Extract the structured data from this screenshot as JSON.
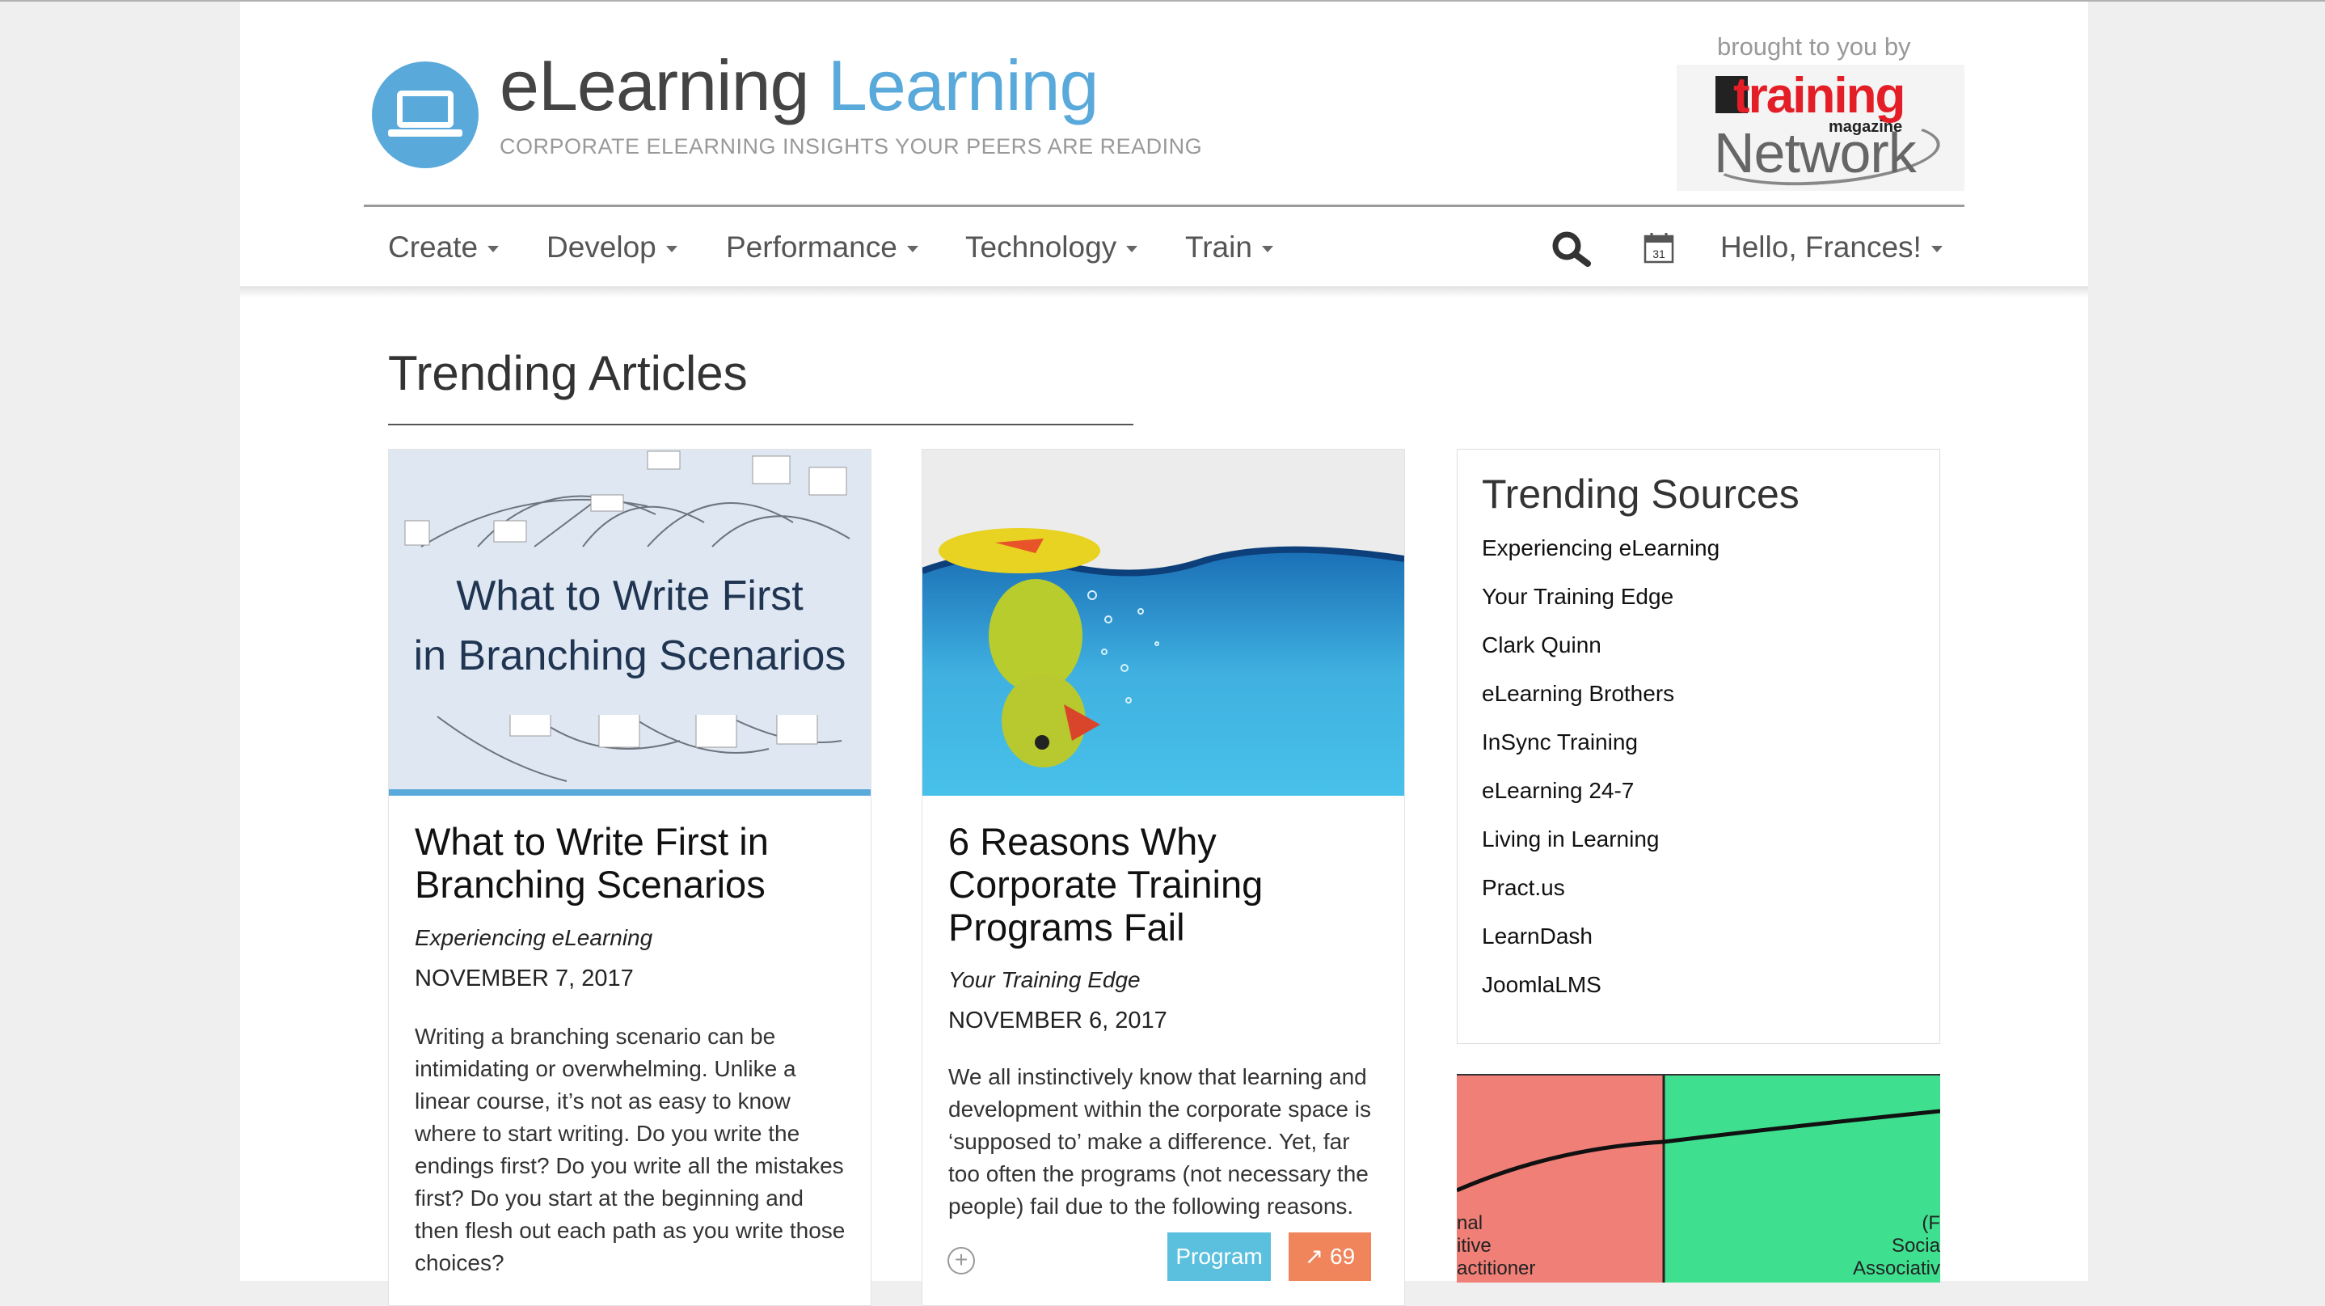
{
  "header": {
    "logo_part1": "eLearning",
    "logo_part2": "Learning",
    "tagline": "CORPORATE ELEARNING INSIGHTS YOUR PEERS ARE READING",
    "brought_by": "brought to you by",
    "sponsor_training": "training",
    "sponsor_magazine": "magazine",
    "sponsor_network": "Network"
  },
  "nav": {
    "items": [
      "Create",
      "Develop",
      "Performance",
      "Technology",
      "Train"
    ],
    "user": "Hello, Frances!",
    "calendar_day": "31"
  },
  "main": {
    "section_title": "Trending Articles",
    "articles": [
      {
        "image_text_1": "What to Write First",
        "image_text_2": "in Branching Scenarios",
        "title": "What to Write First in Branching Scenarios",
        "source": "Experiencing eLearning",
        "date": "NOVEMBER 7, 2017",
        "excerpt": "Writing a branching scenario can be intimidating or overwhelming. Unlike a linear course, it’s not as easy to know where to start writing. Do you write the endings first? Do you write all the mistakes first? Do you start at the beginning and then flesh out each path as you write those choices?"
      },
      {
        "title": "6 Reasons Why Corporate Training Programs Fail",
        "source": "Your Training Edge",
        "date": "NOVEMBER 6, 2017",
        "excerpt": "We all instinctively know that learning and development within the corporate space is ‘supposed to’ make a difference. Yet, far too often the programs (not necessary the people) fail due to the following reasons.",
        "tag": "Program",
        "trend_count": "69",
        "trend_icon": "trending-up-icon"
      }
    ]
  },
  "sidebar": {
    "title": "Trending Sources",
    "sources": [
      "Experiencing eLearning",
      "Your Training Edge",
      "Clark Quinn",
      "eLearning Brothers",
      "InSync Training",
      "eLearning 24-7",
      "Living in Learning",
      "Pract.us",
      "LearnDash",
      "JoomlaLMS"
    ],
    "ad_left_text_1": "nal",
    "ad_left_text_2": "itive",
    "ad_left_text_3": "actitioner",
    "ad_right_text_1": "(F",
    "ad_right_text_2": "Socia",
    "ad_right_text_3": "Associativ"
  },
  "colors": {
    "brand_blue": "#5aa9db",
    "logo_dark": "#444444",
    "tag_blue": "#5bc0de",
    "trend_orange": "#f0855c",
    "sponsor_red": "#e41e26"
  }
}
